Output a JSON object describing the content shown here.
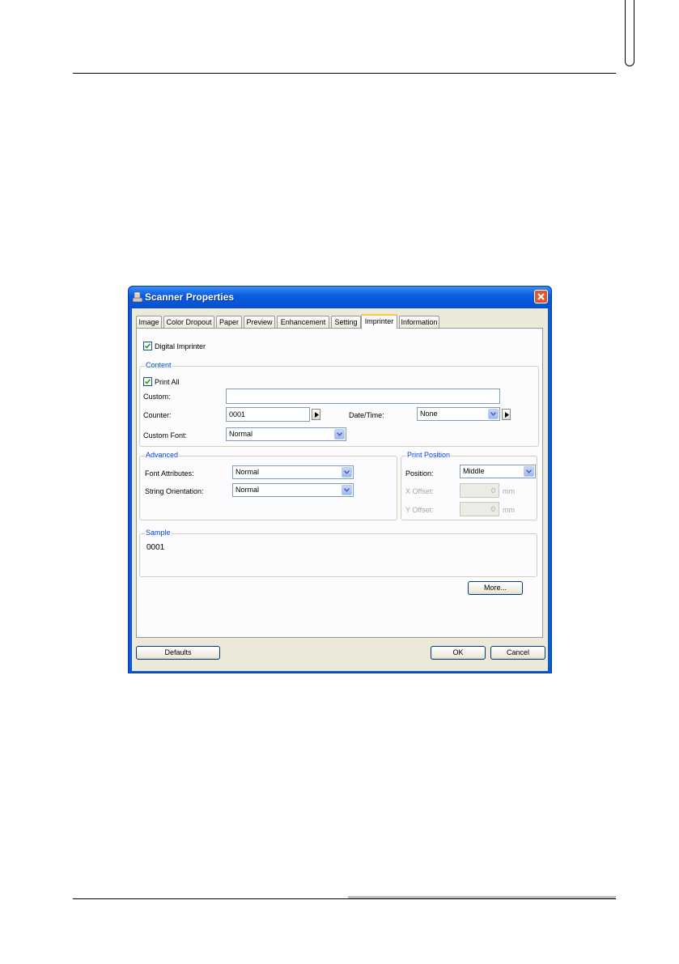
{
  "window": {
    "title": "Scanner Properties"
  },
  "tabs": [
    {
      "label": "Image"
    },
    {
      "label": "Color Dropout"
    },
    {
      "label": "Paper"
    },
    {
      "label": "Preview"
    },
    {
      "label": "Enhancement"
    },
    {
      "label": "Setting"
    },
    {
      "label": "Imprinter",
      "active": true
    },
    {
      "label": "Information"
    }
  ],
  "imprinter": {
    "digital_imprinter": {
      "label": "Digital Imprinter",
      "checked": true
    },
    "content": {
      "legend": "Content",
      "print_all": {
        "label": "Print All",
        "checked": true
      },
      "custom_label": "Custom:",
      "custom_value": "",
      "counter_label": "Counter:",
      "counter_value": "0001",
      "datetime_label": "Date/Time:",
      "datetime_value": "None",
      "custom_font_label": "Custom Font:",
      "custom_font_value": "Normal"
    },
    "advanced": {
      "legend": "Advanced",
      "font_attributes_label": "Font Attributes:",
      "font_attributes_value": "Normal",
      "string_orientation_label": "String Orientation:",
      "string_orientation_value": "Normal"
    },
    "print_position": {
      "legend": "Print Position",
      "position_label": "Position:",
      "position_value": "Middle",
      "x_offset_label": "X Offset:",
      "x_offset_value": "0",
      "y_offset_label": "Y Offset:",
      "y_offset_value": "0",
      "unit": "mm"
    },
    "sample": {
      "legend": "Sample",
      "text": "0001"
    },
    "more_button": "More..."
  },
  "footer": {
    "defaults_button": "Defaults",
    "ok_button": "OK",
    "cancel_button": "Cancel"
  },
  "colors": {
    "title_bar": "#0a5ee0",
    "dialog_face": "#ece9d8",
    "legend_text": "#0046d5",
    "active_tab_accent": "#ffc83c"
  }
}
